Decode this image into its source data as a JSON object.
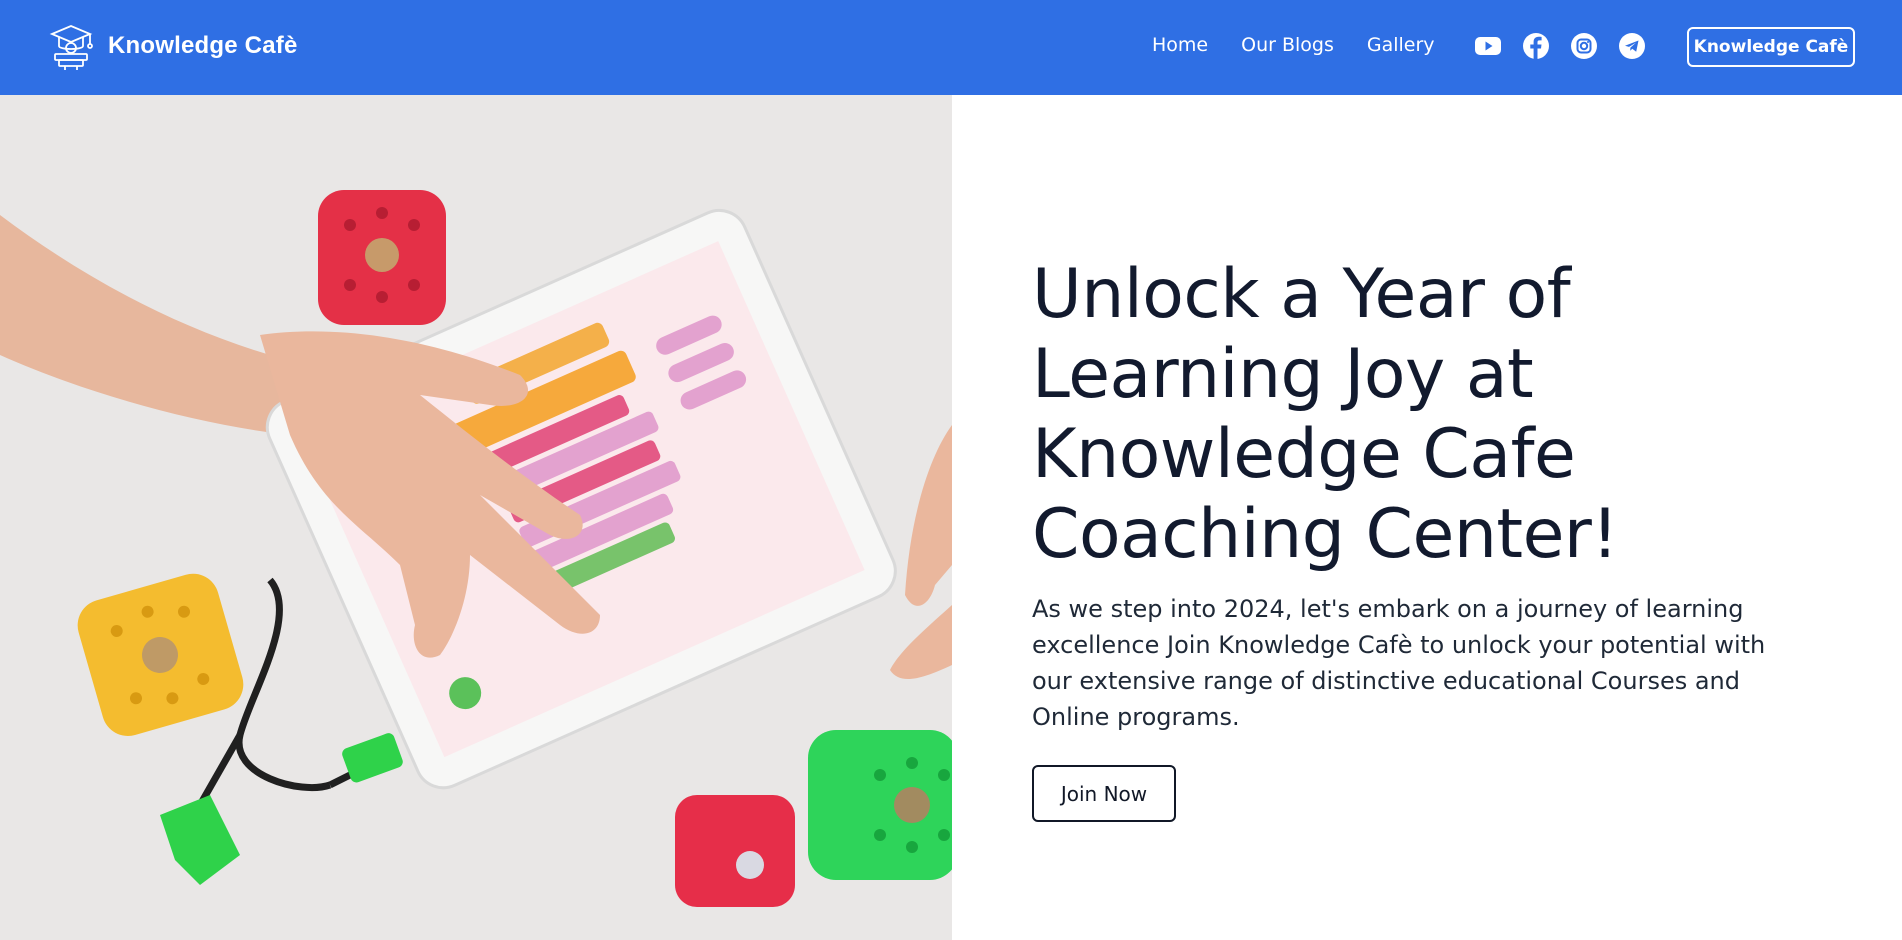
{
  "header": {
    "brand_name": "Knowledge Cafè",
    "nav": [
      {
        "label": "Home"
      },
      {
        "label": "Our Blogs"
      },
      {
        "label": "Gallery"
      }
    ],
    "socials": [
      "youtube-icon",
      "facebook-icon",
      "instagram-icon",
      "telegram-icon"
    ],
    "cta_label": "Knowledge Cafè"
  },
  "hero": {
    "title": "Unlock a Year of Learning Joy at Knowledge Cafe Coaching Center!",
    "description": "As we step into 2024, let's embark on a journey of learning excellence Join Knowledge Cafè to unlock your potential with our extensive range of distinctive educational Courses and Online programs.",
    "button_label": "Join Now",
    "image_alt": "Child's hands using a tablet coding app with colorful robot cubes"
  },
  "colors": {
    "header_bg": "#2f6fe4",
    "title": "#121a2e",
    "text": "#1f2937"
  }
}
